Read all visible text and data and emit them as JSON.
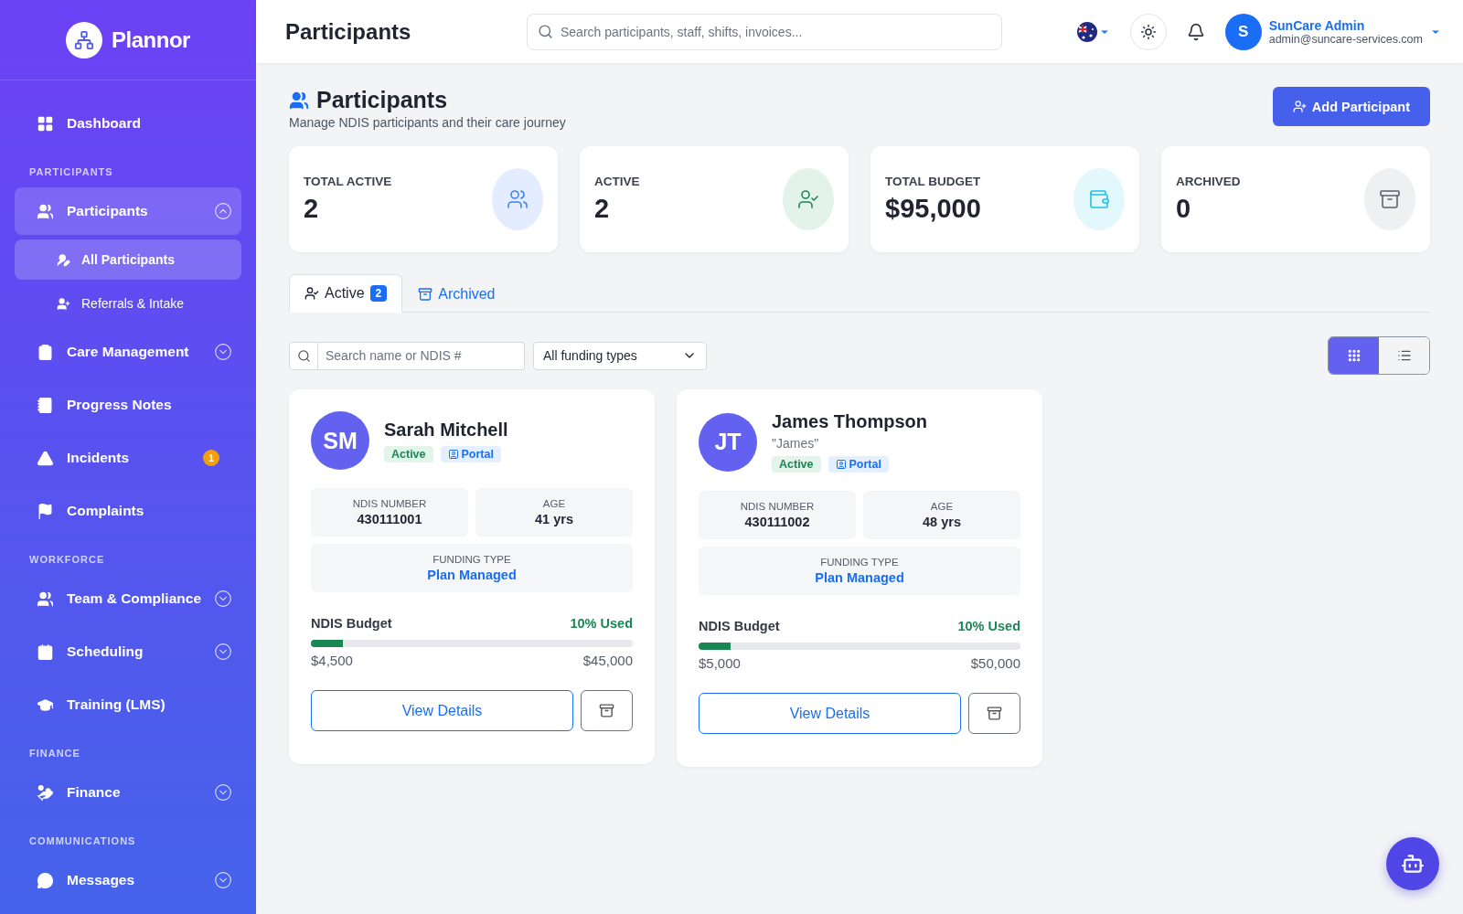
{
  "brand": "Plannor",
  "nav": [
    {
      "kind": "link",
      "label": "Dashboard",
      "selected": false
    },
    {
      "kind": "section",
      "label": "PARTICIPANTS"
    },
    {
      "kind": "link",
      "label": "Participants",
      "selected": true,
      "expanded": true,
      "children": [
        {
          "label": "All Participants",
          "selected": true
        },
        {
          "label": "Referrals & Intake",
          "selected": false
        }
      ]
    },
    {
      "kind": "link",
      "label": "Care Management",
      "selected": false,
      "expanded": false
    },
    {
      "kind": "link",
      "label": "Progress Notes",
      "selected": false
    },
    {
      "kind": "link",
      "label": "Incidents",
      "selected": false,
      "badge": "1"
    },
    {
      "kind": "link",
      "label": "Complaints",
      "selected": false
    },
    {
      "kind": "section",
      "label": "WORKFORCE"
    },
    {
      "kind": "link",
      "label": "Team & Compliance",
      "selected": false,
      "expanded": false
    },
    {
      "kind": "link",
      "label": "Scheduling",
      "selected": false,
      "expanded": false
    },
    {
      "kind": "link",
      "label": "Training (LMS)",
      "selected": false
    },
    {
      "kind": "section",
      "label": "FINANCE"
    },
    {
      "kind": "link",
      "label": "Finance",
      "selected": false,
      "expanded": false
    },
    {
      "kind": "section",
      "label": "COMMUNICATIONS"
    },
    {
      "kind": "link",
      "label": "Messages",
      "selected": false,
      "expanded": false
    }
  ],
  "header": {
    "title": "Participants",
    "search": {
      "placeholder": "Search participants, staff, shifts, invoices..."
    },
    "user": {
      "initial": "S",
      "name": "SunCare Admin",
      "email": "admin@suncare-services.com"
    }
  },
  "page": {
    "title": "Participants",
    "subtitle": "Manage NDIS participants and their care journey",
    "add_button": "Add Participant"
  },
  "stats": [
    {
      "label": "TOTAL ACTIVE",
      "value": "2",
      "color": "#e3edff"
    },
    {
      "label": "ACTIVE",
      "value": "2",
      "color": "#e4f3ea"
    },
    {
      "label": "TOTAL BUDGET",
      "value": "$95,000",
      "color": "#e2f8fd"
    },
    {
      "label": "ARCHIVED",
      "value": "0",
      "color": "#eef0f2"
    }
  ],
  "tabs": [
    {
      "label": "Active",
      "count": "2",
      "selected": true
    },
    {
      "label": "Archived",
      "selected": false
    }
  ],
  "filters": {
    "search": {
      "placeholder": "Search name or NDIS #"
    },
    "funding": {
      "value": "All funding types"
    }
  },
  "view_modes": [
    {
      "kind": "grid",
      "selected": true
    },
    {
      "kind": "list",
      "selected": false
    }
  ],
  "participants": [
    {
      "initials": "SM",
      "name": "Sarah Mitchell",
      "status": "Active",
      "portal": "Portal",
      "ndis_label": "NDIS NUMBER",
      "ndis": "430111001",
      "age_label": "AGE",
      "age": "41 yrs",
      "funding_label": "FUNDING TYPE",
      "funding": "Plan Managed",
      "budget_label": "NDIS Budget",
      "used": "10% Used",
      "level": 0.1,
      "spent": "$4,500",
      "total": "$45,000",
      "action": "View Details"
    },
    {
      "initials": "JT",
      "name": "James Thompson",
      "nickname": "\"James\"",
      "status": "Active",
      "portal": "Portal",
      "ndis_label": "NDIS NUMBER",
      "ndis": "430111002",
      "age_label": "AGE",
      "age": "48 yrs",
      "funding_label": "FUNDING TYPE",
      "funding": "Plan Managed",
      "budget_label": "NDIS Budget",
      "used": "10% Used",
      "level": 0.1,
      "spent": "$5,000",
      "total": "$50,000",
      "action": "View Details"
    }
  ]
}
